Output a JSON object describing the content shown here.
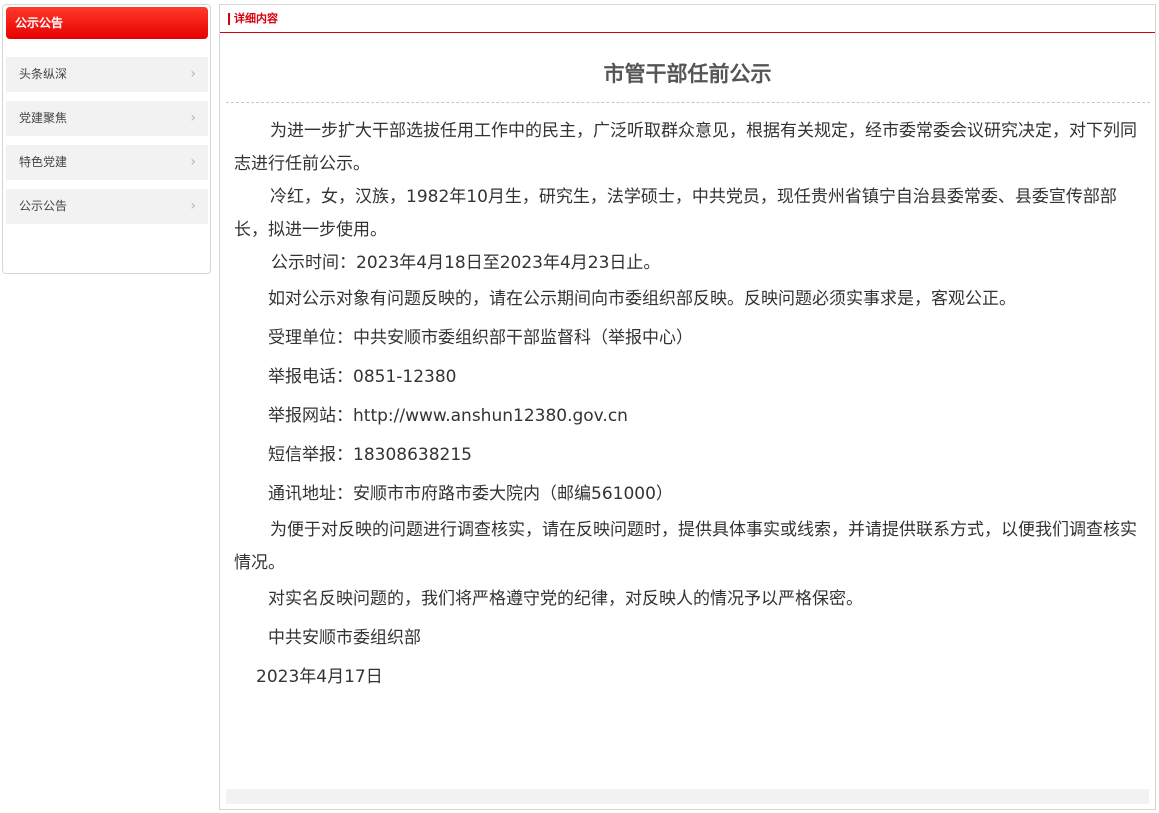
{
  "sidebar": {
    "header": "公示公告",
    "items": [
      {
        "label": "头条纵深"
      },
      {
        "label": "党建聚焦"
      },
      {
        "label": "特色党建"
      },
      {
        "label": "公示公告"
      }
    ]
  },
  "main": {
    "section_label": "详细内容",
    "title": "市管干部任前公示",
    "paragraphs": {
      "intro": "为进一步扩大干部选拔任用工作中的民主，广泛听取群众意见，根据有关规定，经市委常委会议研究决定，对下列同志进行任前公示。",
      "candidate": "冷红，女，汉族，1982年10月生，研究生，法学硕士，中共党员，现任贵州省镇宁自治县委常委、县委宣传部部长，拟进一步使用。",
      "period": "公示时间：2023年4月18日至2023年4月23日止。",
      "feedback": "如对公示对象有问题反映的，请在公示期间向市委组织部反映。反映问题必须实事求是，客观公正。",
      "unit": "受理单位：中共安顺市委组织部干部监督科（举报中心）",
      "phone": "举报电话：0851-12380",
      "website": "举报网站：http://www.anshun12380.gov.cn",
      "sms": "短信举报：18308638215",
      "address": "通讯地址：安顺市市府路市委大院内（邮编561000）",
      "investigation": "为便于对反映的问题进行调查核实，请在反映问题时，提供具体事实或线索，并请提供联系方式，以便我们调查核实情况。",
      "confidential": "对实名反映问题的，我们将严格遵守党的纪律，对反映人的情况予以严格保密。",
      "signature": "中共安顺市委组织部",
      "date": "2023年4月17日"
    }
  },
  "icons": {
    "sidebar_chevron": "chevron-right-icon"
  },
  "colors": {
    "accent_red": "#e60000",
    "sidebar_item_bg": "#f2f2f2"
  }
}
